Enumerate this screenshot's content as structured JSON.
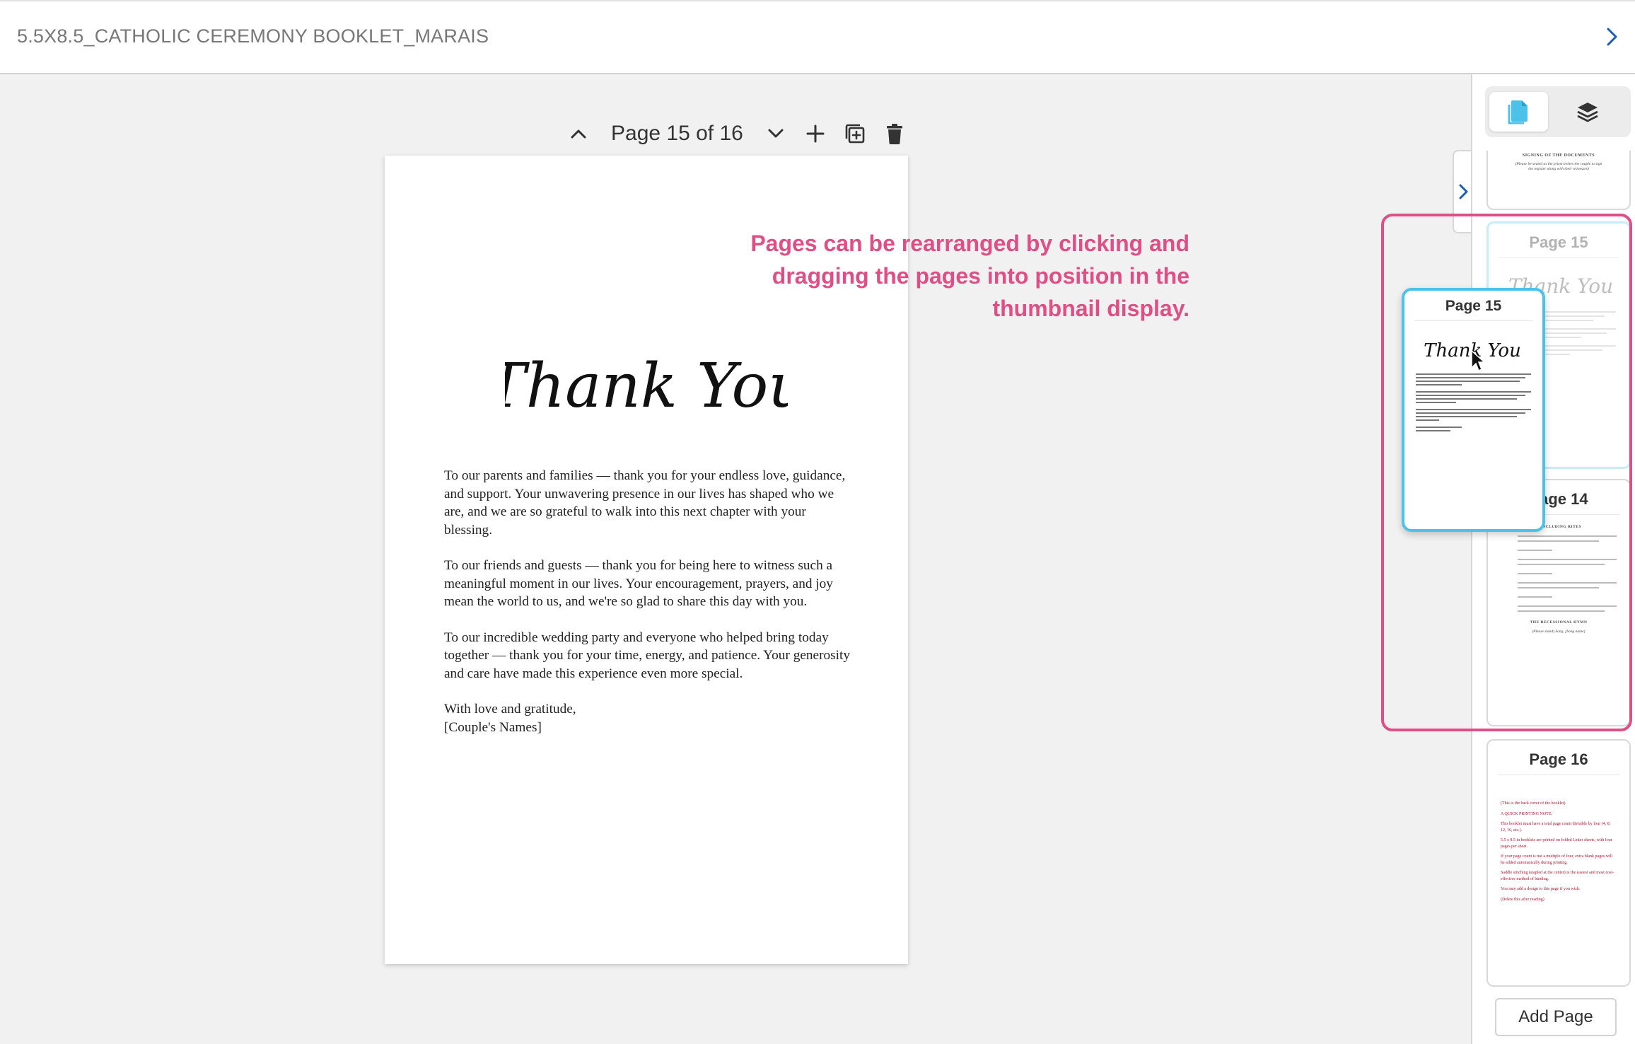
{
  "header": {
    "doc_title": "5.5X8.5_CATHOLIC CEREMONY BOOKLET_MARAIS",
    "collapse_icon": "chevron-right-icon"
  },
  "toolbar": {
    "page_label": "Page 15 of 16",
    "icons": [
      "chevron-up-icon",
      "chevron-down-icon",
      "plus-icon",
      "duplicate-icon",
      "trash-icon"
    ]
  },
  "page": {
    "script_title": "Thank You",
    "paragraphs": [
      "To our parents and families — thank you for your endless love, guidance, and support. Your unwavering presence in our lives has shaped who we are, and we are so grateful to walk into this next chapter with your blessing.",
      "To our friends and guests — thank you for being here to witness such a meaningful moment in our lives. Your encouragement, prayers, and joy mean the world to us, and we're so glad to share this day with you.",
      "To our incredible wedding party and everyone who helped bring today together — thank you for your time, energy, and patience. Your generosity and care have made this experience even more special."
    ],
    "closing": "With love and gratitude,",
    "names": "[Couple's Names]"
  },
  "hint": {
    "text": "Pages can be rearranged by clicking and dragging the pages into position in the thumbnail display.",
    "color": "#df4f86"
  },
  "sidebar": {
    "tab_pages_icon": "pages-icon",
    "tab_layers_icon": "layers-icon",
    "expand_icon": "chevron-right-icon",
    "accent": "#4cc1e9",
    "thumbs": {
      "top_heading": "SIGNING OF THE DOCUMENTS",
      "top_note": "(Please be seated as the priest invites the couple to sign the register along with their witnesses)",
      "slot_15_title": "Page 15",
      "drag_title": "Page 15",
      "page14_title": "Page 14",
      "page14_heading": "CONCLUDING RITES",
      "page14_heading2": "THE RECESSIONAL HYMN",
      "page14_hymn": "(Please stand) Song, [Song name]",
      "page16_title": "Page 16",
      "page16_lines": [
        "(This is the back cover of the booklet)",
        "A QUICK PRINTING NOTE:",
        "This booklet must have a total page count divisible by four (4, 8, 12, 16, etc.).",
        "5.5 x 8.5 in booklets are printed on folded Letter sheets, with four pages per sheet.",
        "If your page count is not a multiple of four, extra blank pages will be added automatically during printing.",
        "Saddle stitching (stapled at the center) is the easiest and most cost-effective method of binding.",
        "You may add a design to this page if you wish.",
        "(Delete this after reading)"
      ]
    },
    "add_page_label": "Add Page"
  }
}
